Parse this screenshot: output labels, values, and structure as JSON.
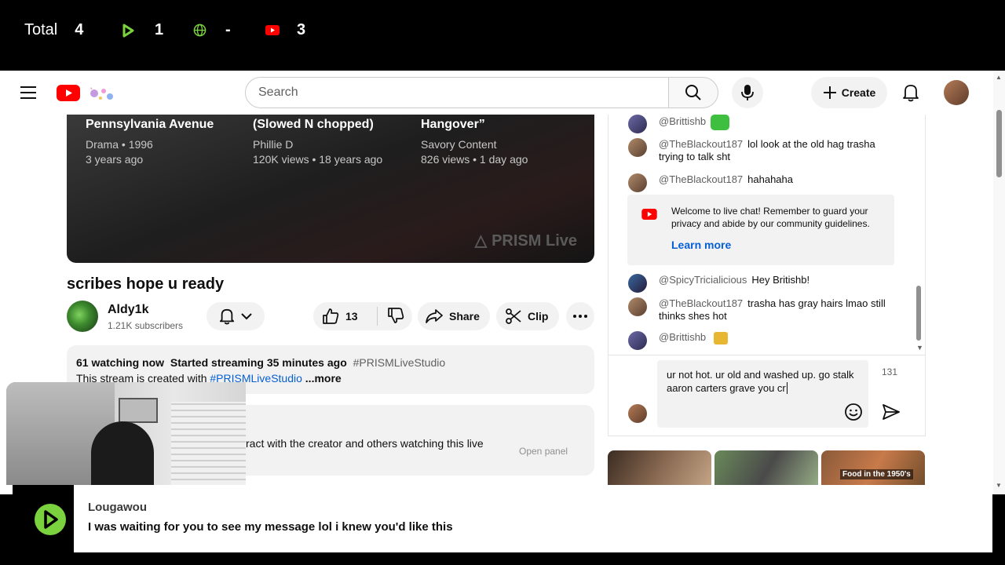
{
  "stats": {
    "total_label": "Total",
    "total_value": "4",
    "play_value": "1",
    "globe_value": "-",
    "youtube_value": "3"
  },
  "header": {
    "search_placeholder": "Search",
    "create_label": "Create"
  },
  "video": {
    "endcards": [
      {
        "title": "Pennsylvania Avenue",
        "line1": "Drama • 1996",
        "line2": "3 years ago"
      },
      {
        "title": "(Slowed N chopped)",
        "line1": "Phillie D",
        "line2": "120K views • 18 years ago"
      },
      {
        "title": "Hangover”",
        "line1": "Savory Content",
        "line2": "826 views • 1 day ago"
      }
    ],
    "watermark": "PRISM Live",
    "title": "scribes hope u ready"
  },
  "channel": {
    "name": "Aldy1k",
    "subscribers": "1.21K subscribers"
  },
  "actions": {
    "likes": "13",
    "share": "Share",
    "clip": "Clip"
  },
  "description": {
    "watching": "61 watching now",
    "started": "Started streaming 35 minutes ago",
    "hashtag": "#PRISMLiveStudio",
    "created_prefix": "This stream is created with",
    "created_link": "#PRISMLiveStudio",
    "more": "...more"
  },
  "chat_panel": {
    "text": "ract with the creator and others watching this live",
    "open_panel": "Open panel"
  },
  "chat": {
    "messages": [
      {
        "author": "@Brittishb",
        "text": ""
      },
      {
        "author": "@TheBlackout187",
        "text": "lol look at the old hag trasha trying to talk sht"
      },
      {
        "author": "@TheBlackout187",
        "text": "hahahaha"
      },
      {
        "author": "@SpicyTricialicious",
        "text": "Hey Britishb!"
      },
      {
        "author": "@TheBlackout187",
        "text": "trasha has gray hairs lmao still thinks shes hot"
      },
      {
        "author": "@Brittishb",
        "text": ""
      }
    ],
    "welcome_text": "Welcome to live chat! Remember to guard your privacy and abide by our community guidelines.",
    "learn_more": "Learn more",
    "input_text": "ur not hot. ur old and washed up. go stalk aaron carters grave you cr",
    "char_count": "131"
  },
  "thumbnails": {
    "third_caption": "Food in the 1950's"
  },
  "notification": {
    "user": "Lougawou",
    "message": "I was waiting for you to see my message lol i knew you'd like this"
  },
  "colors": {
    "youtube_red": "#ff0000",
    "prism_green": "#7bd23f",
    "link_blue": "#065fd4"
  }
}
